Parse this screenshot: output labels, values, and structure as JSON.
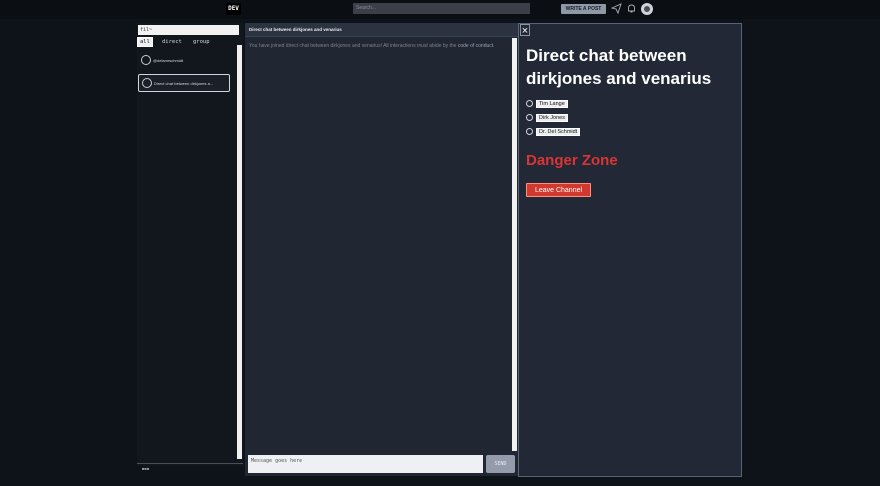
{
  "topbar": {
    "logo": "DEV",
    "search_placeholder": "Search...",
    "write_button": "WRITE A POST",
    "icons": [
      "connect-icon",
      "bell-icon",
      "avatar"
    ]
  },
  "sidebar": {
    "filter_value": "fil~",
    "tabs": [
      {
        "label": "all",
        "active": true
      },
      {
        "label": "direct",
        "active": false
      },
      {
        "label": "group",
        "active": false
      }
    ],
    "conversations": [
      {
        "label": "@delamrschmidt",
        "selected": false
      },
      {
        "label": "Direct chat between dirkjones a...",
        "selected": true
      }
    ],
    "footer": "■■■"
  },
  "chat": {
    "title": "Direct chat between dirkjones and venarius",
    "notice_pre": "You have joined direct chat between dirkjones and venarius! All interactions ",
    "notice_must": "must",
    "notice_mid": " abide by the ",
    "notice_link": "code of conduct",
    "notice_end": ".",
    "input_placeholder": "Message goes here",
    "send_label": "SEND"
  },
  "details": {
    "close_label": "×",
    "title": "Direct chat between dirkjones and venarius",
    "members": [
      {
        "name": "Tim Lange"
      },
      {
        "name": "Dirk Jones"
      },
      {
        "name": "Dr. Del Schmidt"
      }
    ],
    "danger_heading": "Danger Zone",
    "leave_label": "Leave Channel"
  },
  "colors": {
    "background": "#0e1219",
    "panel": "#202632",
    "danger": "#d93535",
    "leave_button": "#d1392f"
  }
}
